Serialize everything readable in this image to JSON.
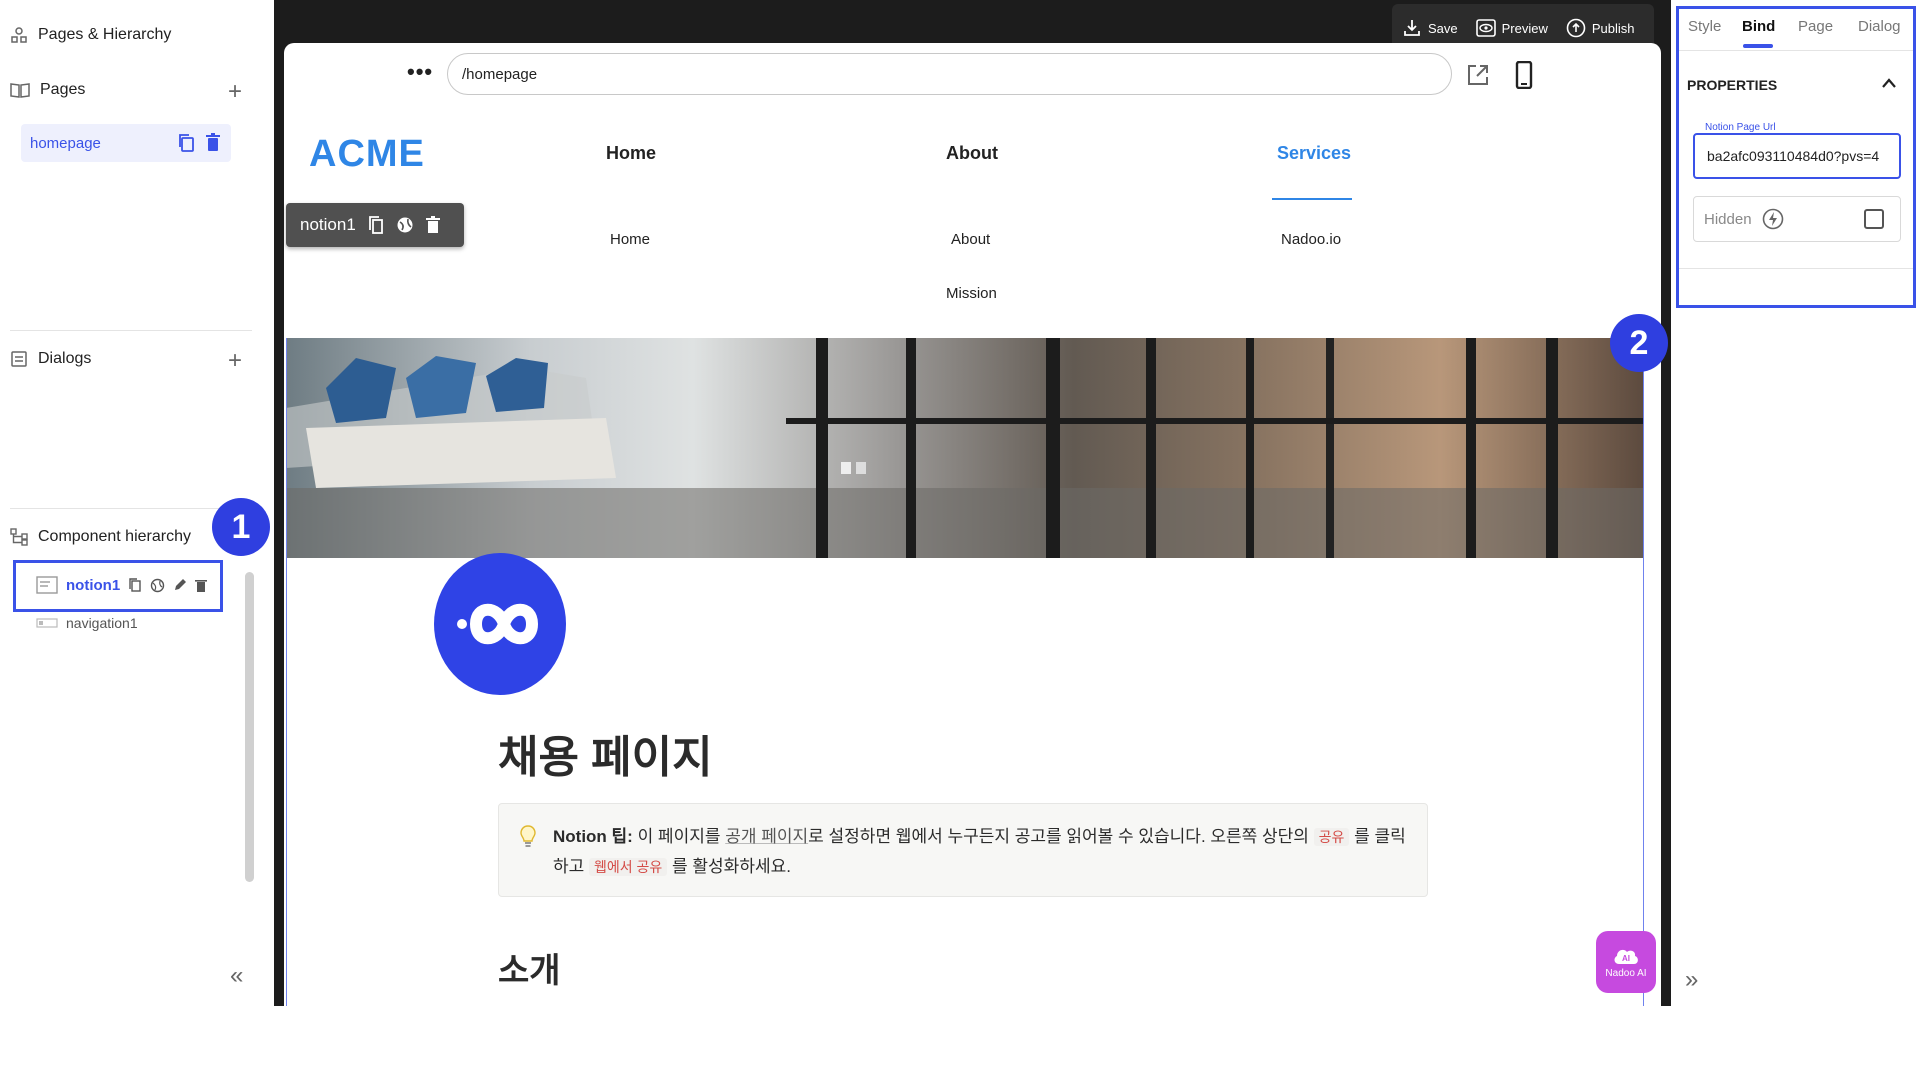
{
  "left": {
    "pages_hierarchy_title": "Pages & Hierarchy",
    "pages_title": "Pages",
    "pages": [
      {
        "label": "homepage"
      }
    ],
    "dialogs_title": "Dialogs",
    "component_hierarchy_title": "Component hierarchy",
    "components": [
      {
        "label": "notion1"
      },
      {
        "label": "navigation1"
      }
    ],
    "collapse_glyph": "«"
  },
  "markers": {
    "one": "1",
    "two": "2"
  },
  "topbar": {
    "save": "Save",
    "preview": "Preview",
    "publish": "Publish"
  },
  "url": {
    "path": "/homepage",
    "more": "•••"
  },
  "site": {
    "logo": "ACME",
    "nav": [
      {
        "label": "Home",
        "sub": [
          "Home"
        ]
      },
      {
        "label": "About",
        "sub": [
          "About",
          "Mission"
        ]
      },
      {
        "label": "Services",
        "sub": [
          "Nadoo.io"
        ]
      }
    ],
    "accent": "#2f86e6"
  },
  "selected_chip": {
    "label": "notion1"
  },
  "notion": {
    "title": "채용 페이지",
    "callout": {
      "bold": "Notion 팁:",
      "t1": " 이 페이지를 ",
      "link": "공개 페이지",
      "t2": "로 설정하면 웹에서 누구든지 공고를 읽어볼 수 있습니다. 오른쪽 상단의 ",
      "tag1": "공유",
      "t3": " 를 클릭하고 ",
      "tag2": "웹에서 공유",
      "t4": " 를 활성화하세요."
    },
    "intro": "소개"
  },
  "ai_button": {
    "label": "Nadoo AI",
    "badge": "AI"
  },
  "right": {
    "tabs": [
      "Style",
      "Bind",
      "Page",
      "Dialog"
    ],
    "active_tab": "Bind",
    "properties_title": "PROPERTIES",
    "notion_url_label": "Notion Page Url",
    "notion_url_value": "ba2afc093110484d0?pvs=4",
    "hidden_label": "Hidden",
    "collapse_glyph": "»"
  },
  "colors": {
    "primary": "#3a52e8",
    "ai": "#c64adf",
    "notion_icon": "#2f43e6"
  }
}
